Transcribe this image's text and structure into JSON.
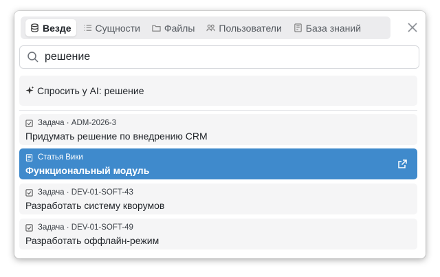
{
  "tabs": [
    {
      "label": "Везде",
      "icon": "database-icon",
      "active": true
    },
    {
      "label": "Сущности",
      "icon": "list-icon",
      "active": false
    },
    {
      "label": "Файлы",
      "icon": "folder-icon",
      "active": false
    },
    {
      "label": "Пользователи",
      "icon": "users-icon",
      "active": false
    },
    {
      "label": "База знаний",
      "icon": "document-icon",
      "active": false
    }
  ],
  "search": {
    "value": "решение",
    "placeholder": ""
  },
  "ask_ai": {
    "label": "Спросить у AI: решение",
    "icon": "sparkle-icon"
  },
  "results": [
    {
      "meta": "Задача · ADM-2026-3",
      "title": "Придумать решение по внедрению CRM",
      "icon": "checkbox-icon",
      "selected": false
    },
    {
      "meta": "Статья Вики",
      "title": "Функциональный модуль",
      "icon": "document-icon",
      "selected": true
    },
    {
      "meta": "Задача · DEV-01-SOFT-43",
      "title": "Разработать систему кворумов",
      "icon": "checkbox-icon",
      "selected": false
    },
    {
      "meta": "Задача · DEV-01-SOFT-49",
      "title": "Разработать оффлайн-режим",
      "icon": "checkbox-icon",
      "selected": false
    }
  ],
  "colors": {
    "accent": "#3f8acc",
    "tab_bar": "#ececee",
    "item_bg": "#f5f5f6"
  }
}
